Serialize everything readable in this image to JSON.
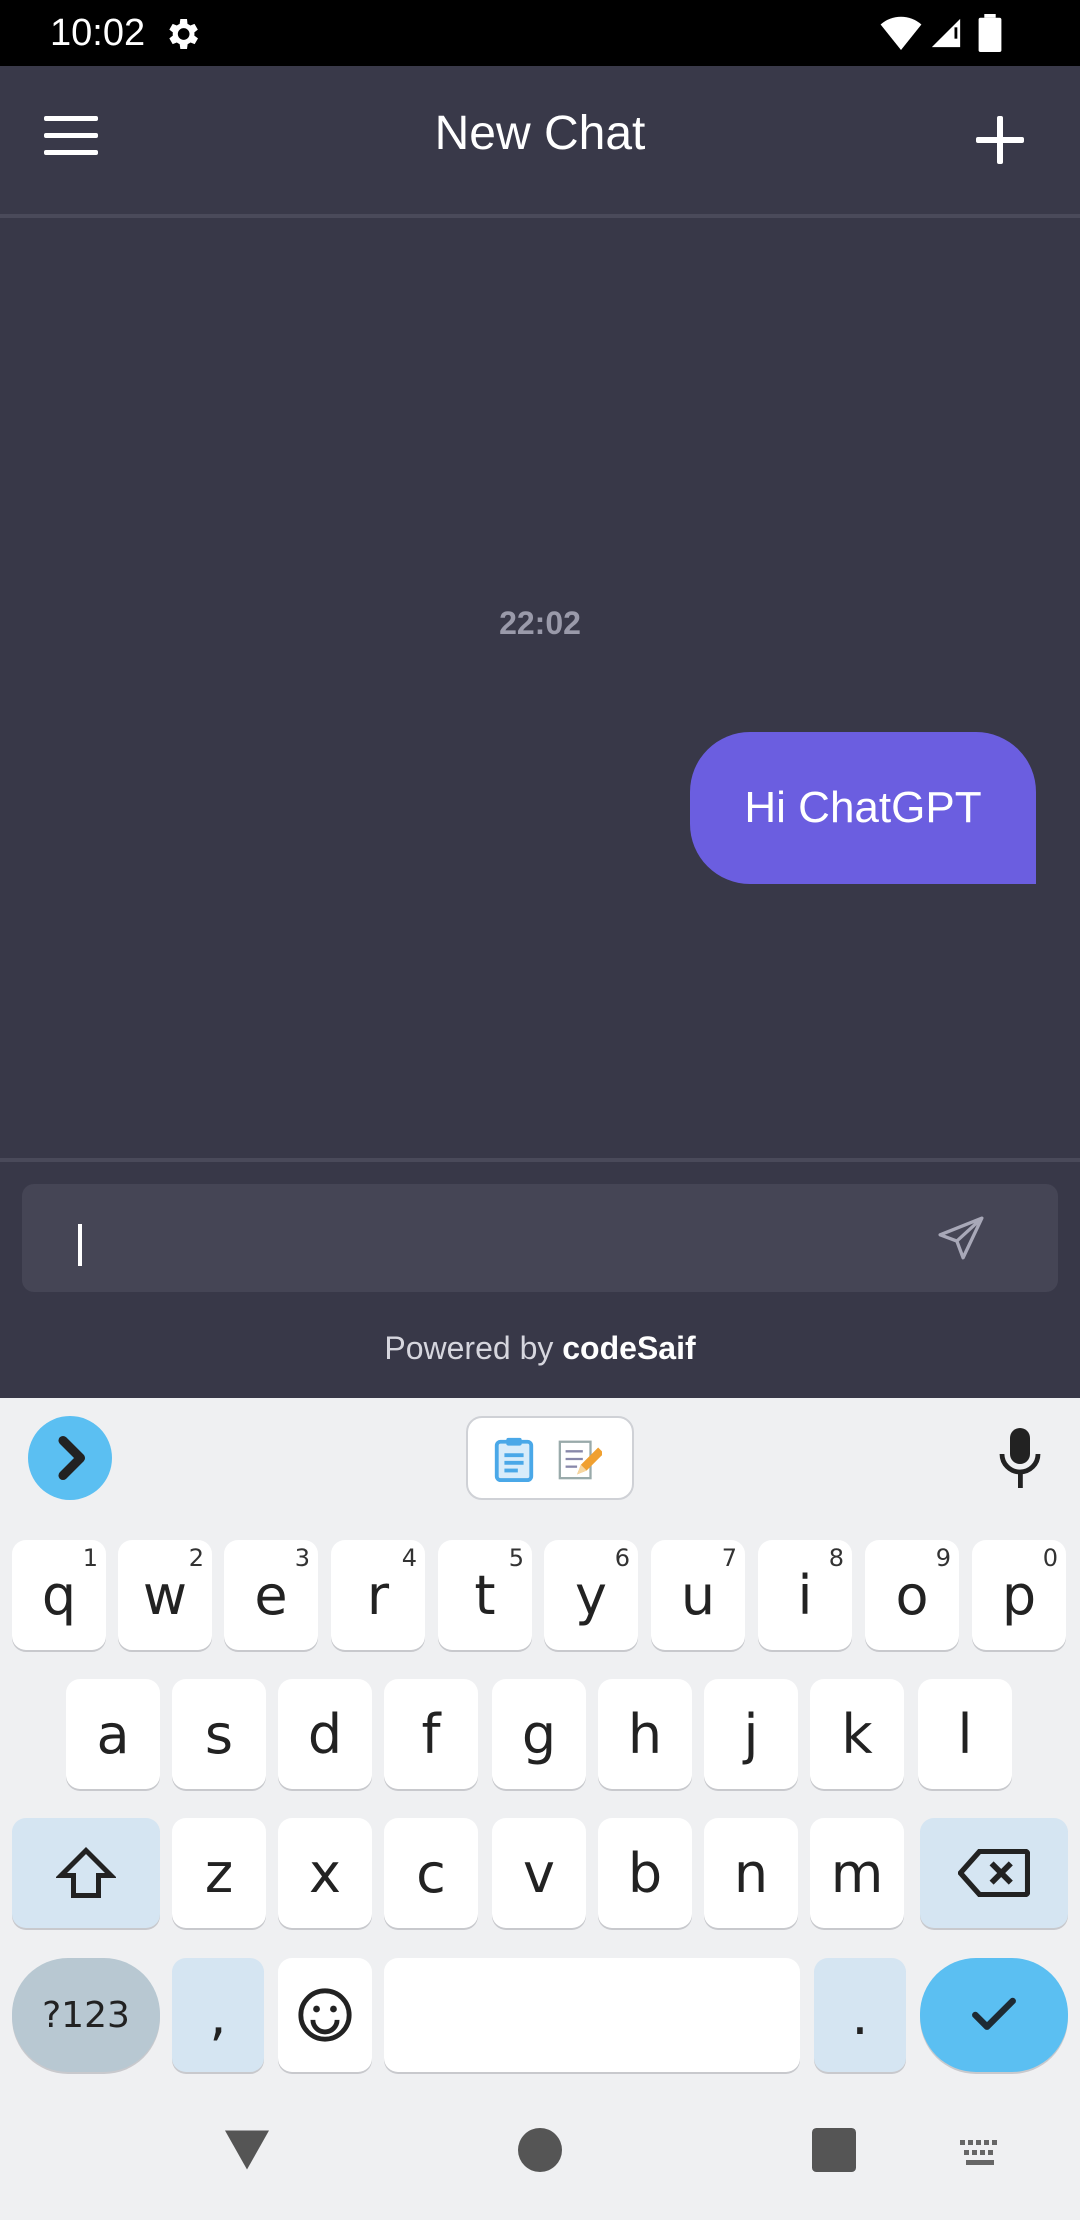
{
  "status_bar": {
    "time": "10:02"
  },
  "app_bar": {
    "title": "New Chat"
  },
  "chat": {
    "timestamp": "22:02",
    "messages": [
      {
        "role": "user",
        "text": "Hi ChatGPT"
      }
    ]
  },
  "composer": {
    "value": "",
    "powered_prefix": "Powered by",
    "powered_brand": "codeSaif"
  },
  "keyboard": {
    "row1": [
      {
        "key": "q",
        "hint": "1"
      },
      {
        "key": "w",
        "hint": "2"
      },
      {
        "key": "e",
        "hint": "3"
      },
      {
        "key": "r",
        "hint": "4"
      },
      {
        "key": "t",
        "hint": "5"
      },
      {
        "key": "y",
        "hint": "6"
      },
      {
        "key": "u",
        "hint": "7"
      },
      {
        "key": "i",
        "hint": "8"
      },
      {
        "key": "o",
        "hint": "9"
      },
      {
        "key": "p",
        "hint": "0"
      }
    ],
    "row2": [
      "a",
      "s",
      "d",
      "f",
      "g",
      "h",
      "j",
      "k",
      "l"
    ],
    "row3": [
      "z",
      "x",
      "c",
      "v",
      "b",
      "n",
      "m"
    ],
    "symbols_label": "?123",
    "comma": ",",
    "period": "."
  },
  "colors": {
    "background": "#383848",
    "accent": "#6b5ee0",
    "keyboard_accent": "#5bbff2"
  }
}
